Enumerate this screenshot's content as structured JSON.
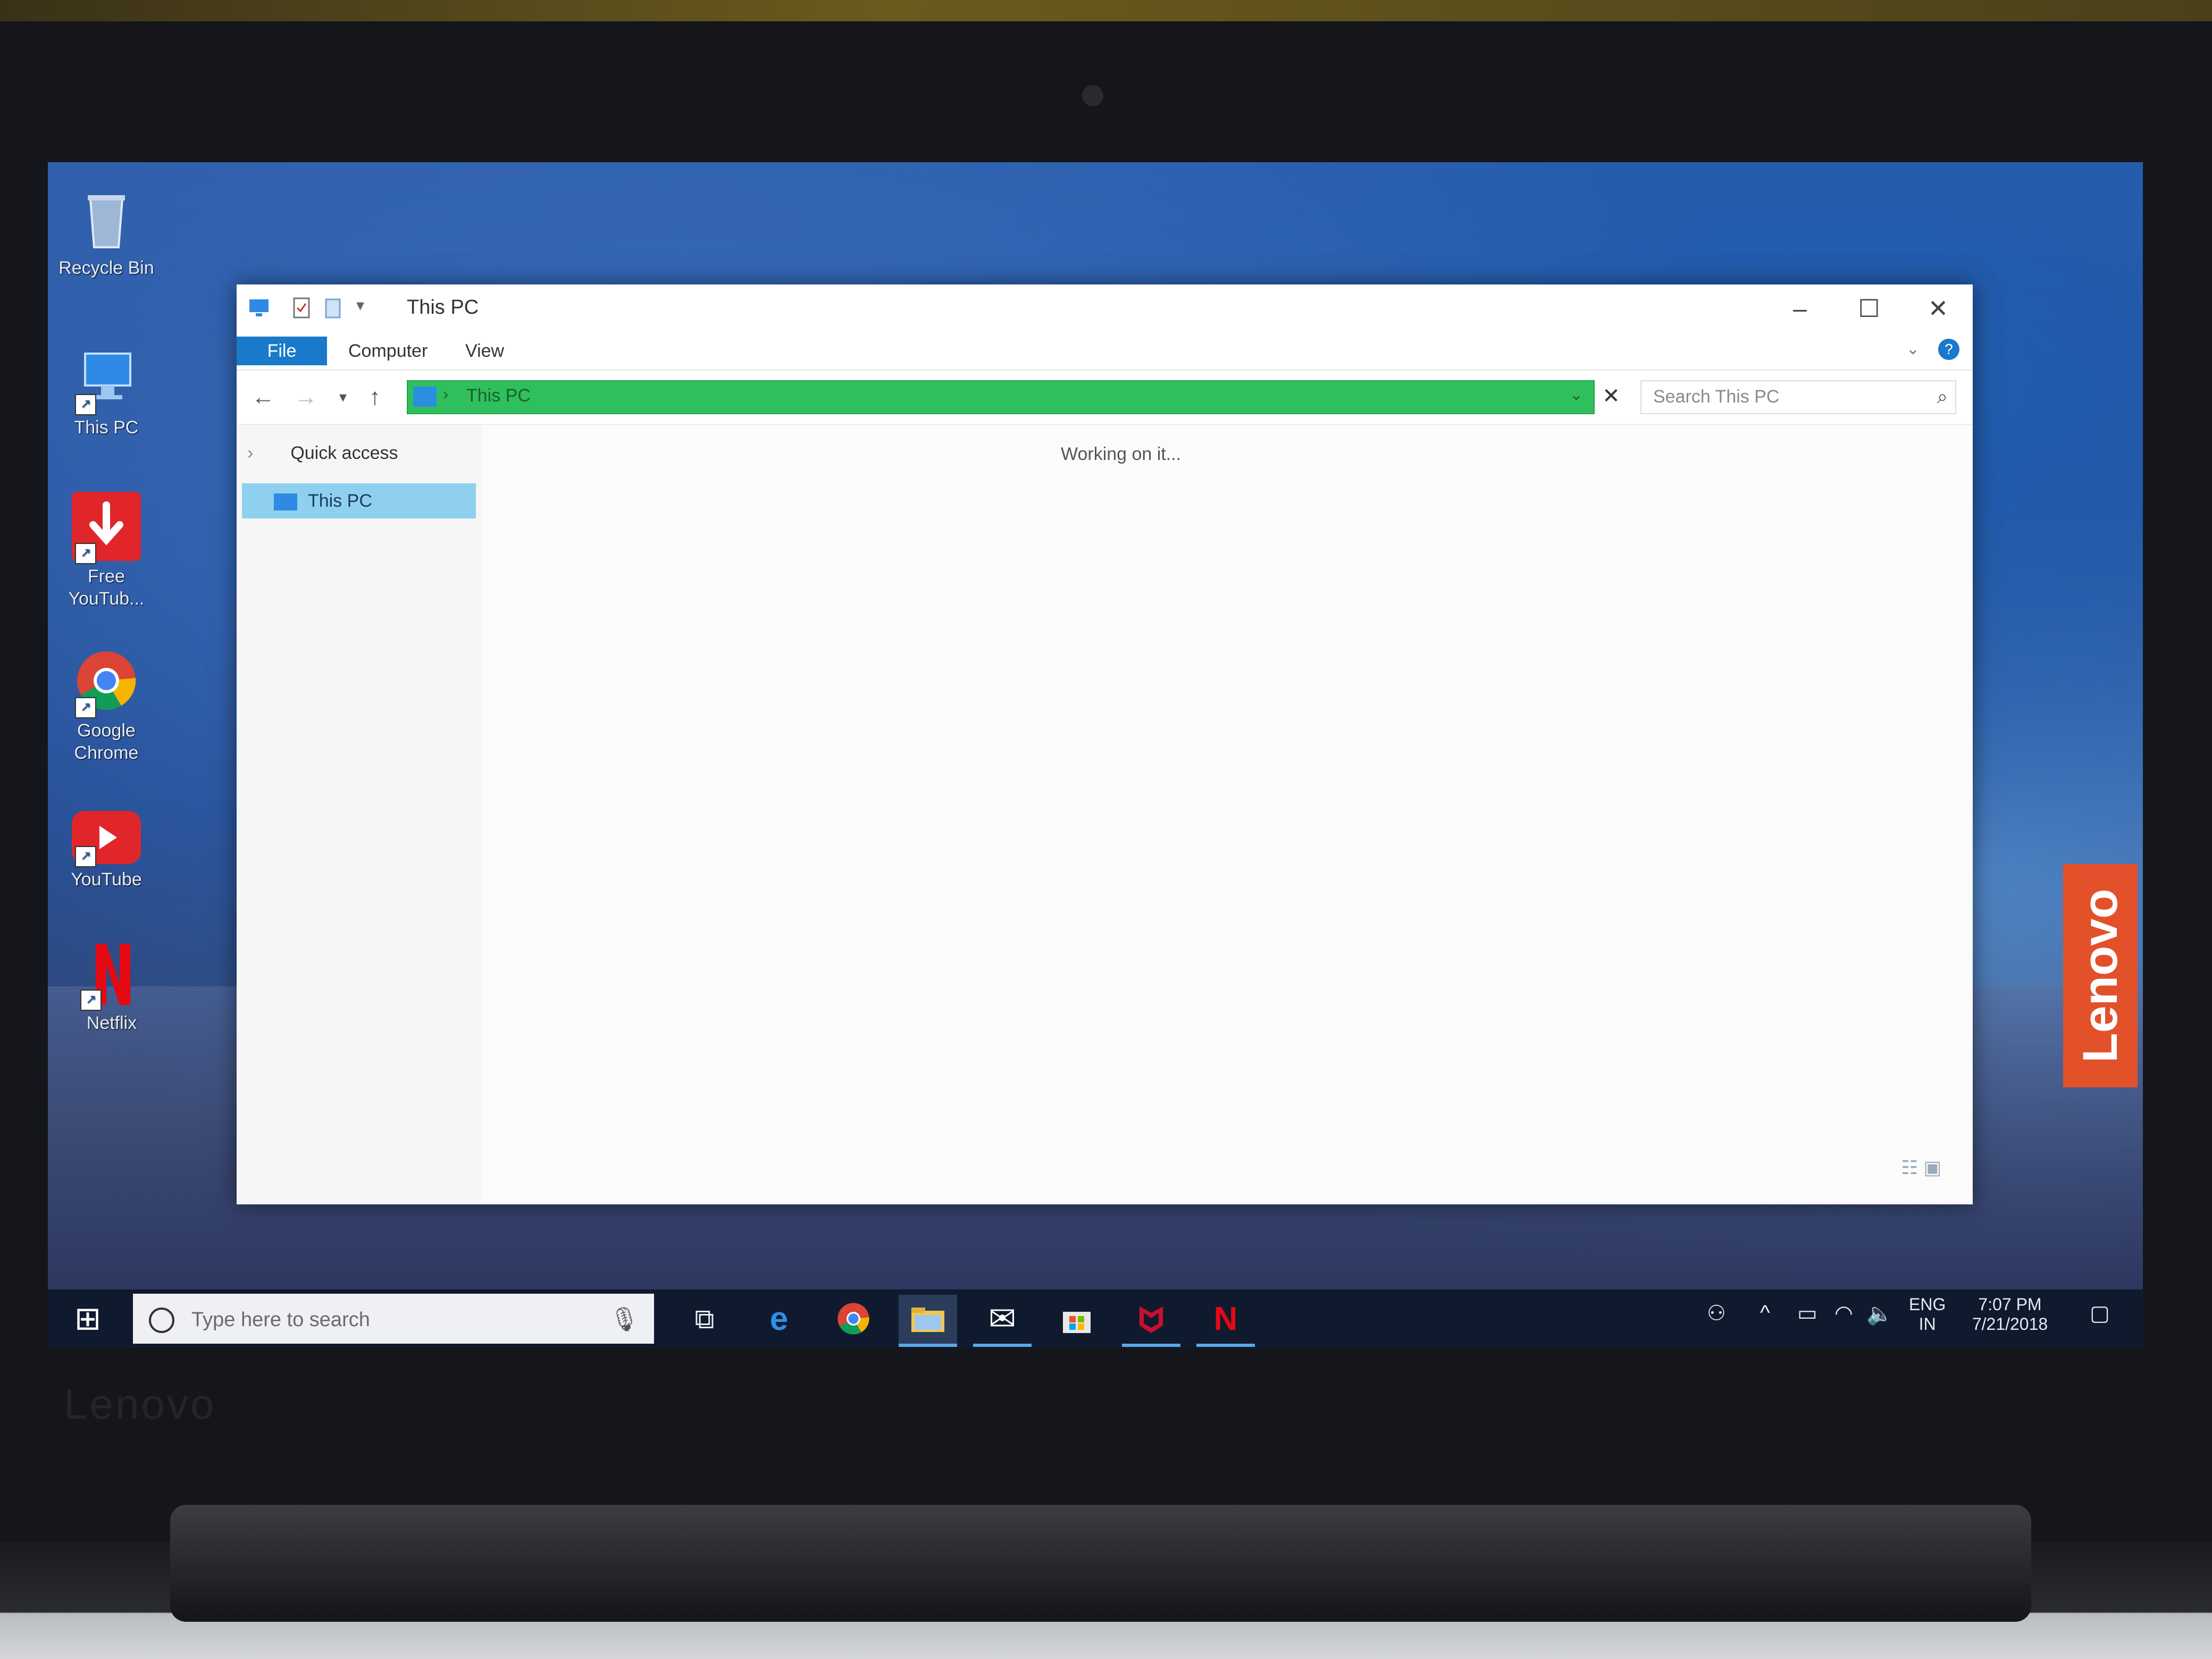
{
  "desktop": {
    "icons": [
      {
        "label": "Recycle Bin",
        "icon": "recycle-bin-icon"
      },
      {
        "label": "This PC",
        "icon": "this-pc-icon"
      },
      {
        "label": "Free YouTub...",
        "icon": "download-icon"
      },
      {
        "label": "Google Chrome",
        "icon": "chrome-icon"
      },
      {
        "label": "YouTube",
        "icon": "youtube-icon"
      },
      {
        "label": "Netflix",
        "icon": "netflix-icon"
      }
    ],
    "brand_tag": "Lenovo",
    "bezel_logo": "Lenovo"
  },
  "explorer": {
    "title": "This PC",
    "tabs": [
      "File",
      "Computer",
      "View"
    ],
    "address": "This PC",
    "search_placeholder": "Search This PC",
    "nav": {
      "quick_access": "Quick access",
      "this_pc": "This PC"
    },
    "status": "Working on it...",
    "accent": "#1979ca",
    "address_bar_color": "#2fbf5c"
  },
  "taskbar": {
    "search_placeholder": "Type here to search",
    "apps": [
      "task-view",
      "edge",
      "chrome",
      "file-explorer",
      "mail",
      "store",
      "mcafee",
      "netflix"
    ],
    "language": {
      "top": "ENG",
      "bottom": "IN"
    },
    "time": "7:07 PM",
    "date": "7/21/2018"
  }
}
